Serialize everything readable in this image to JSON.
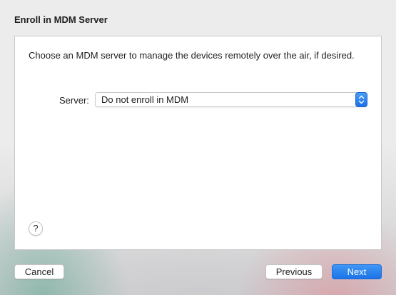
{
  "header": {
    "title": "Enroll in MDM Server"
  },
  "main": {
    "description": "Choose an MDM server to manage the devices remotely over the air, if desired.",
    "server_label": "Server:",
    "server_select": {
      "selected": "Do not enroll in MDM"
    },
    "help_label": "?"
  },
  "footer": {
    "cancel_label": "Cancel",
    "previous_label": "Previous",
    "next_label": "Next"
  },
  "colors": {
    "accent": "#1b73e8"
  },
  "icons": {
    "stepper": "chevron-up-down-icon",
    "help": "help-icon"
  }
}
